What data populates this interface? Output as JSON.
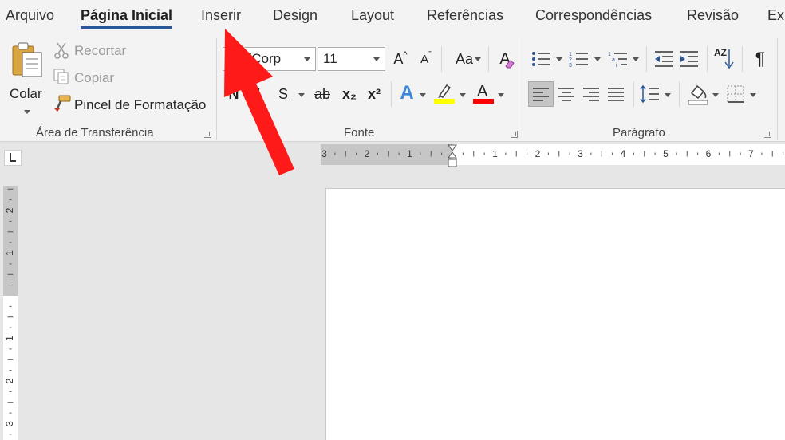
{
  "tabs": [
    {
      "label": "Arquivo",
      "active": false
    },
    {
      "label": "Página Inicial",
      "active": true
    },
    {
      "label": "Inserir",
      "active": false
    },
    {
      "label": "Design",
      "active": false
    },
    {
      "label": "Layout",
      "active": false
    },
    {
      "label": "Referências",
      "active": false
    },
    {
      "label": "Correspondências",
      "active": false
    },
    {
      "label": "Revisão",
      "active": false
    },
    {
      "label": "Ex",
      "active": false
    }
  ],
  "clipboard": {
    "group_label": "Área de Transferência",
    "paste_label": "Colar",
    "cut_label": "Recortar",
    "copy_label": "Copiar",
    "format_painter_label": "Pincel de Formatação"
  },
  "font": {
    "group_label": "Fonte",
    "font_name": "ori (Corp",
    "font_size": "11",
    "bold_label": "N",
    "italic_label": "I",
    "underline_label": "S",
    "strike_label": "ab",
    "subscript_label": "x₂",
    "superscript_label": "x²",
    "case_label": "Aa",
    "grow_label": "A",
    "shrink_label": "A",
    "clear_label": "A",
    "effects_label": "A",
    "color_label": "A",
    "highlight_color": "#ffff00",
    "font_color": "#ff0000"
  },
  "paragraph": {
    "group_label": "Parágrafo",
    "sort_label": "AZ",
    "show_marks_label": "¶"
  },
  "ruler": {
    "horizontal_labels": [
      "3",
      "2",
      "1",
      "1",
      "2",
      "3",
      "4",
      "5",
      "6",
      "7"
    ],
    "vertical_labels": [
      "2",
      "1",
      "1",
      "2",
      "3"
    ]
  },
  "colors": {
    "accent": "#2b579a",
    "arrow": "#ff1a1a"
  }
}
